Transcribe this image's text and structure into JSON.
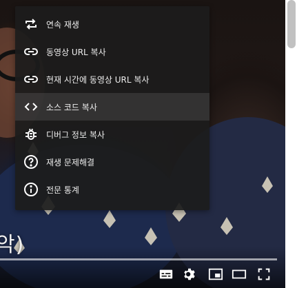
{
  "menu": {
    "items": [
      {
        "label": "연속 재생",
        "icon": "loop-icon"
      },
      {
        "label": "동영상 URL 복사",
        "icon": "link-icon"
      },
      {
        "label": "현재 시간에 동영상 URL 복사",
        "icon": "link-icon"
      },
      {
        "label": "소스 코드 복사",
        "icon": "code-icon"
      },
      {
        "label": "디버그 정보 복사",
        "icon": "bug-icon"
      },
      {
        "label": "재생 문제해결",
        "icon": "help-icon"
      },
      {
        "label": "전문 통계",
        "icon": "info-icon"
      }
    ],
    "highlighted_index": 3
  },
  "subtitle": {
    "text": "악)"
  },
  "controls": {
    "buttons": [
      "subtitles-icon",
      "gear-icon",
      "miniplayer-icon",
      "theater-mode-icon",
      "fullscreen-icon"
    ]
  },
  "colors": {
    "menu_bg": "#1c1c1c",
    "menu_text": "#eeeeee",
    "highlight_bg": "#3a3a3a"
  }
}
